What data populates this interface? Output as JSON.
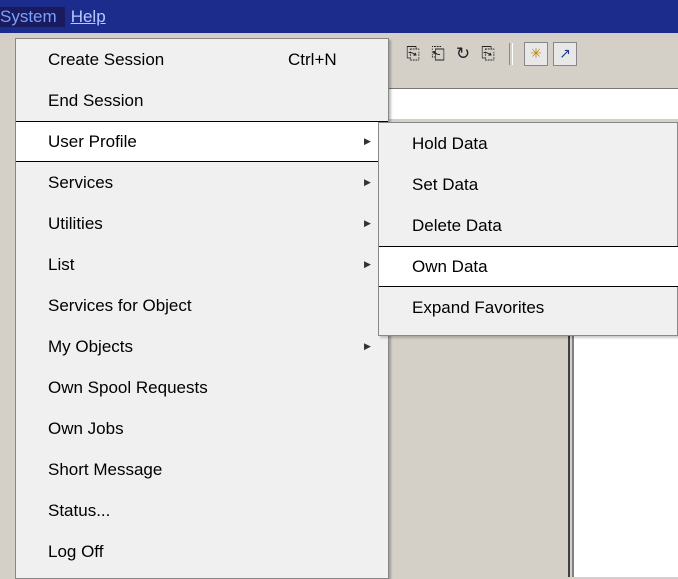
{
  "menubar": {
    "items": [
      {
        "label": "System",
        "selected": true
      },
      {
        "label": "Help",
        "selected": false
      }
    ]
  },
  "toolbar": {
    "icons": [
      "create-session-icon",
      "open-icon",
      "refresh-icon",
      "create-icon",
      "layout-icon",
      "shortcut-icon"
    ]
  },
  "system_menu": {
    "items": [
      {
        "label": "Create Session",
        "shortcut": "Ctrl+N",
        "submenu": false
      },
      {
        "label": "End Session",
        "submenu": false
      },
      {
        "label": "User Profile",
        "submenu": true,
        "highlighted": true
      },
      {
        "label": "Services",
        "submenu": true
      },
      {
        "label": "Utilities",
        "submenu": true
      },
      {
        "label": "List",
        "submenu": true
      },
      {
        "label": "Services for Object",
        "submenu": false
      },
      {
        "label": "My Objects",
        "submenu": true
      },
      {
        "label": "Own Spool Requests",
        "submenu": false
      },
      {
        "label": "Own Jobs",
        "submenu": false
      },
      {
        "label": "Short Message",
        "submenu": false
      },
      {
        "label": "Status...",
        "submenu": false
      },
      {
        "label": "Log Off",
        "submenu": false
      }
    ]
  },
  "user_profile_submenu": {
    "items": [
      {
        "label": "Hold Data"
      },
      {
        "label": "Set Data"
      },
      {
        "label": "Delete Data"
      },
      {
        "label": "Own Data",
        "highlighted": true
      },
      {
        "label": "Expand Favorites"
      }
    ]
  },
  "colors": {
    "menubar_bg": "#1c2c8c",
    "menu_bg": "#f0f0f0",
    "highlight_bg": "#ffffff",
    "window_bg": "#d4d0c8"
  }
}
